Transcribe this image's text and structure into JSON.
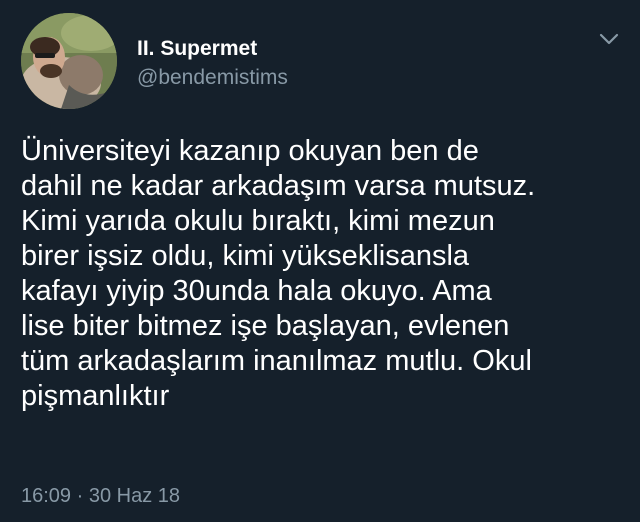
{
  "tweet": {
    "author": {
      "display_name": "II. Supermet",
      "handle": "@bendemistims"
    },
    "text_lines": [
      "Üniversiteyi kazanıp okuyan ben de",
      "dahil ne kadar arkadaşım varsa mutsuz.",
      "Kimi yarıda okulu bıraktı, kimi mezun",
      "birer işsiz oldu, kimi yükseklisansla",
      "kafayı yiyip 30unda hala okuyo. Ama",
      "lise biter bitmez işe başlayan, evlenen",
      "tüm arkadaşlarım inanılmaz mutlu. Okul",
      "pişmanlıktır"
    ],
    "timestamp": "16:09 · 30 Haz 18",
    "menu_icon": "chevron-down-icon"
  },
  "colors": {
    "background": "#15202b",
    "primary_text": "#ffffff",
    "secondary_text": "#8899a6"
  }
}
